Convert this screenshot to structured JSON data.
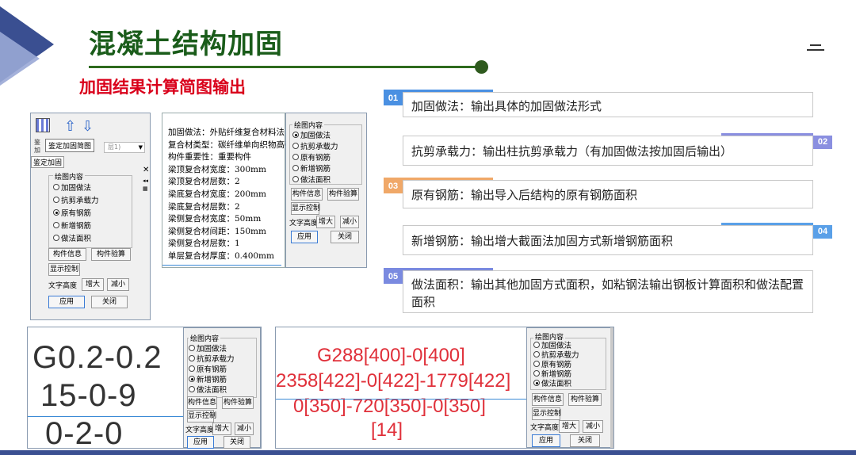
{
  "header": {
    "title": "混凝土结构加固",
    "subtitle": "加固结果计算简图输出",
    "menu_icon": "menu-icon"
  },
  "left_panel": {
    "tooltip": "鉴定加固简图",
    "side_chars": "鉴加",
    "combo_value": "层1)",
    "tab_label": "鉴定加固",
    "close_glyph": "✕",
    "pin_glyphs": "◂◂\n▦",
    "group_title": "绘图内容",
    "options": [
      "加固做法",
      "抗剪承载力",
      "原有钢筋",
      "新增钢筋",
      "做法面积"
    ],
    "selected_index": 2,
    "buttons": {
      "member_info": "构件信息",
      "member_check": "构件验算",
      "display_control": "显示控制",
      "text_height": "文字高度",
      "enlarge": "增大",
      "shrink": "减小",
      "apply": "应用",
      "close": "关闭"
    }
  },
  "text_panel": {
    "lines": [
      "加固做法：外贴纤维复合材料法",
      "复合材类型：碳纤维单向织物高强度II级",
      "构件重要性：重要构件",
      "梁顶复合材宽度：300mm",
      "梁顶复合材层数：2",
      "梁底复合材宽度：200mm",
      "梁底复合材层数：2",
      "梁侧复合材宽度：50mm",
      "梁侧复合材间距：150mm",
      "梁侧复合材层数：1",
      "单层复合材厚度：0.400mm"
    ]
  },
  "middle_panel": {
    "group_title": "绘图内容",
    "options": [
      "加固做法",
      "抗剪承载力",
      "原有钢筋",
      "新增钢筋",
      "做法面积"
    ],
    "selected_index": 0,
    "buttons": {
      "member_info": "构件信息",
      "member_check": "构件验算",
      "display_control": "显示控制",
      "text_height": "文字高度",
      "enlarge": "增大",
      "shrink": "减小",
      "apply": "应用",
      "close": "关闭"
    }
  },
  "cards": [
    {
      "badge": "01",
      "text": "加固做法：输出具体的加固做法形式",
      "badge_color": "#4a90e2",
      "bar_color": "#4a90e2"
    },
    {
      "badge": "02",
      "text": "抗剪承载力：输出柱抗剪承载力（有加固做法按加固后输出）",
      "badge_color": "#8a8fe0",
      "bar_color": "#8a8fe0"
    },
    {
      "badge": "03",
      "text": "原有钢筋：输出导入后结构的原有钢筋面积",
      "badge_color": "#f0a868",
      "bar_color": "#f0a868"
    },
    {
      "badge": "04",
      "text": "新增钢筋：输出增大截面法加固方式新增钢筋面积",
      "badge_color": "#5aa0e8",
      "bar_color": "#5aa0e8"
    },
    {
      "badge": "05",
      "text": "做法面积：输出其他加固方式面积，如粘钢法输出钢板计算面积和做法配置面积",
      "badge_color": "#7a8ae0",
      "bar_color": "#7a8ae0"
    }
  ],
  "bottom_left": {
    "lines": [
      "G0.2-0.2",
      "15-0-9",
      "0-2-0"
    ],
    "group_title": "绘图内容",
    "options": [
      "加固做法",
      "抗剪承载力",
      "原有钢筋",
      "新增钢筋",
      "做法面积"
    ],
    "selected_index": 3,
    "buttons": {
      "member_info": "构件信息",
      "member_check": "构件验算",
      "display_control": "显示控制",
      "text_height": "文字高度",
      "enlarge": "增大",
      "shrink": "减小",
      "apply": "应用",
      "close": "关闭"
    }
  },
  "bottom_right": {
    "lines": [
      "G288[400]-0[400]",
      "2358[422]-0[422]-1779[422]",
      "0[350]-720[350]-0[350]",
      "[14]"
    ],
    "group_title": "绘图内容",
    "options": [
      "加固做法",
      "抗剪承载力",
      "原有钢筋",
      "新增钢筋",
      "做法面积"
    ],
    "selected_index": 4,
    "buttons": {
      "member_info": "构件信息",
      "member_check": "构件验算",
      "display_control": "显示控制",
      "text_height": "文字高度",
      "enlarge": "增大",
      "shrink": "减小",
      "apply": "应用",
      "close": "关闭"
    }
  },
  "colors": {
    "title_green": "#1a5c1a",
    "subtitle_red": "#d9001b",
    "accent_blue": "#3a4f91",
    "drawing_red": "#e0303a"
  }
}
